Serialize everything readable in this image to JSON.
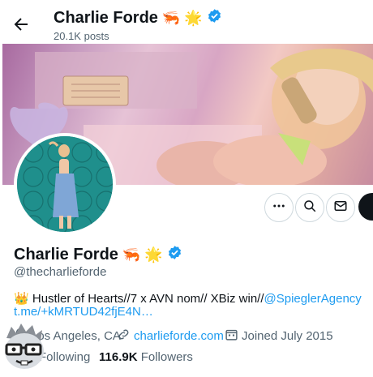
{
  "header": {
    "name": "Charlie Forde",
    "posts_count": "20.1K posts"
  },
  "profile": {
    "display_name": "Charlie Forde",
    "handle": "@thecharlieforde",
    "emojis": [
      "🦐",
      "🌟"
    ],
    "verified": true,
    "bio": {
      "emoji": "👑",
      "text": " Hustler of Hearts//7 x AVN nom// XBiz win//",
      "mention": "@SpieglerAgency",
      "link": "t.me/+kMRTUD42fjE4N…"
    },
    "location": "Los Angeles, CA",
    "website": "charlieforde.com",
    "joined": "Joined July 2015",
    "following_label": "Following",
    "followers_count": "116.9K",
    "followers_label": "Followers"
  },
  "icons": {
    "back": "arrow-left-icon",
    "more": "more-icon",
    "search": "search-icon",
    "message": "mail-icon",
    "verified": "verified-badge-icon",
    "location": "location-pin-icon",
    "link": "link-icon",
    "calendar": "calendar-icon"
  },
  "colors": {
    "accent": "#1d9bf0",
    "text_primary": "#0f1419",
    "text_secondary": "#536471"
  }
}
